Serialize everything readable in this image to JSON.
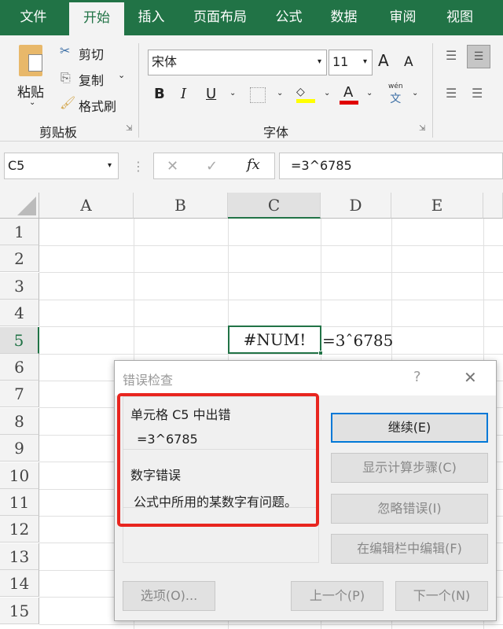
{
  "tabs": [
    "文件",
    "开始",
    "插入",
    "页面布局",
    "公式",
    "数据",
    "审阅",
    "视图"
  ],
  "clipboard": {
    "paste": "粘贴",
    "cut": "剪切",
    "copy": "复制",
    "format_painter": "格式刷",
    "group": "剪贴板"
  },
  "font": {
    "name": "宋体",
    "size": "11",
    "group": "字体",
    "bold": "B",
    "italic": "I",
    "underline": "U",
    "phonetic": "wén",
    "phonetic_char": "文",
    "grow": "A",
    "shrink": "A",
    "color_letter": "A"
  },
  "colors": {
    "accent": "#217346",
    "highlight": "#ffff00",
    "font_color": "#e00000",
    "annotation": "#e8251f"
  },
  "formula_bar": {
    "name_box": "C5",
    "cancel": "✕",
    "enter": "✓",
    "fx": "fx",
    "formula": "=3^6785"
  },
  "columns": [
    "A",
    "B",
    "C",
    "D",
    "E"
  ],
  "rows": [
    "1",
    "2",
    "3",
    "4",
    "5",
    "6",
    "7",
    "8",
    "9",
    "10",
    "11",
    "12",
    "13",
    "14",
    "15"
  ],
  "cells": {
    "C5": "#NUM!",
    "D5": "=3ˆ6785"
  },
  "dialog": {
    "title": "错误检查",
    "help": "?",
    "close": "✕",
    "heading": "单元格 C5 中出错",
    "formula": "=3^6785",
    "error_type": "数字错误",
    "description": "公式中所用的某数字有问题。",
    "buttons": {
      "continue": "继续(E)",
      "show_steps": "显示计算步骤(C)",
      "ignore": "忽略错误(I)",
      "edit": "在编辑栏中编辑(F)",
      "options": "选项(O)...",
      "prev": "上一个(P)",
      "next": "下一个(N)"
    }
  }
}
